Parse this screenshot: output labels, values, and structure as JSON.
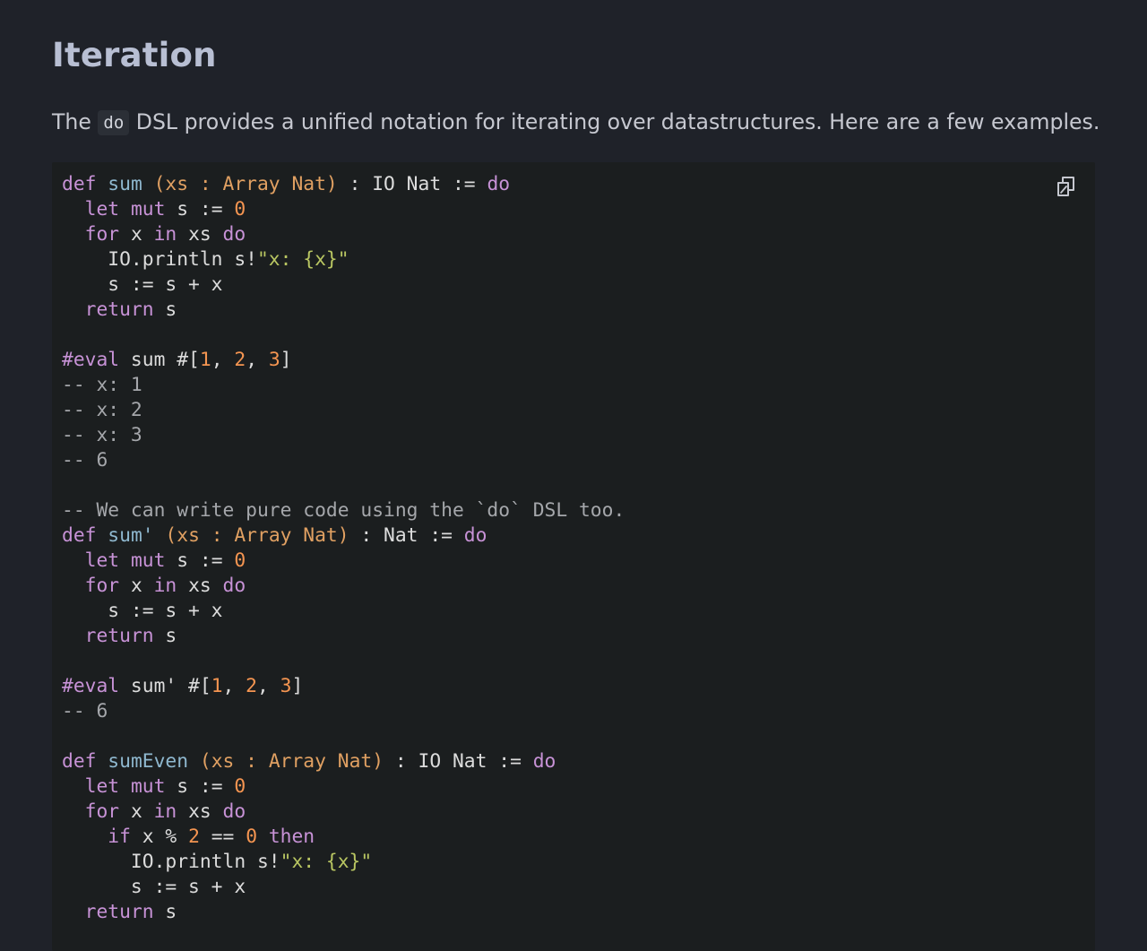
{
  "page": {
    "title": "Iteration",
    "intro_before": "The ",
    "intro_code": "do",
    "intro_after": " DSL provides a unified notation for iterating over datastructures. Here are a few examples."
  },
  "copy_button": {
    "icon": "copy-icon",
    "color": "#c6c8d0"
  },
  "colors": {
    "background": "#1f2229",
    "code_background": "#1b1e1f",
    "keyword": "#c792d6",
    "function_name": "#8fb8cf",
    "binder": "#e0a062",
    "number": "#f59551",
    "string": "#b9c662",
    "comment": "#a5a7ab"
  },
  "code": {
    "lines": [
      [
        {
          "t": "kw",
          "v": "def"
        },
        {
          "t": "txt",
          "v": " "
        },
        {
          "t": "fn",
          "v": "sum"
        },
        {
          "t": "txt",
          "v": " "
        },
        {
          "t": "paren",
          "v": "(xs : Array Nat)"
        },
        {
          "t": "txt",
          "v": " : IO Nat := "
        },
        {
          "t": "kw",
          "v": "do"
        }
      ],
      [
        {
          "t": "txt",
          "v": "  "
        },
        {
          "t": "kw",
          "v": "let"
        },
        {
          "t": "txt",
          "v": " "
        },
        {
          "t": "kw",
          "v": "mut"
        },
        {
          "t": "txt",
          "v": " s := "
        },
        {
          "t": "num",
          "v": "0"
        }
      ],
      [
        {
          "t": "txt",
          "v": "  "
        },
        {
          "t": "kw",
          "v": "for"
        },
        {
          "t": "txt",
          "v": " x "
        },
        {
          "t": "kw",
          "v": "in"
        },
        {
          "t": "txt",
          "v": " xs "
        },
        {
          "t": "kw",
          "v": "do"
        }
      ],
      [
        {
          "t": "txt",
          "v": "    IO.println s!"
        },
        {
          "t": "str",
          "v": "\"x: {x}\""
        }
      ],
      [
        {
          "t": "txt",
          "v": "    s := s + x"
        }
      ],
      [
        {
          "t": "txt",
          "v": "  "
        },
        {
          "t": "kw",
          "v": "return"
        },
        {
          "t": "txt",
          "v": " s"
        }
      ],
      [],
      [
        {
          "t": "kw",
          "v": "#eval"
        },
        {
          "t": "txt",
          "v": " sum #["
        },
        {
          "t": "num",
          "v": "1"
        },
        {
          "t": "txt",
          "v": ", "
        },
        {
          "t": "num",
          "v": "2"
        },
        {
          "t": "txt",
          "v": ", "
        },
        {
          "t": "num",
          "v": "3"
        },
        {
          "t": "txt",
          "v": "]"
        }
      ],
      [
        {
          "t": "cmt",
          "v": "-- x: 1"
        }
      ],
      [
        {
          "t": "cmt",
          "v": "-- x: 2"
        }
      ],
      [
        {
          "t": "cmt",
          "v": "-- x: 3"
        }
      ],
      [
        {
          "t": "cmt",
          "v": "-- 6"
        }
      ],
      [],
      [
        {
          "t": "cmt",
          "v": "-- We can write pure code using the `do` DSL too."
        }
      ],
      [
        {
          "t": "kw",
          "v": "def"
        },
        {
          "t": "txt",
          "v": " "
        },
        {
          "t": "fn",
          "v": "sum'"
        },
        {
          "t": "txt",
          "v": " "
        },
        {
          "t": "paren",
          "v": "(xs : Array Nat)"
        },
        {
          "t": "txt",
          "v": " : Nat := "
        },
        {
          "t": "kw",
          "v": "do"
        }
      ],
      [
        {
          "t": "txt",
          "v": "  "
        },
        {
          "t": "kw",
          "v": "let"
        },
        {
          "t": "txt",
          "v": " "
        },
        {
          "t": "kw",
          "v": "mut"
        },
        {
          "t": "txt",
          "v": " s := "
        },
        {
          "t": "num",
          "v": "0"
        }
      ],
      [
        {
          "t": "txt",
          "v": "  "
        },
        {
          "t": "kw",
          "v": "for"
        },
        {
          "t": "txt",
          "v": " x "
        },
        {
          "t": "kw",
          "v": "in"
        },
        {
          "t": "txt",
          "v": " xs "
        },
        {
          "t": "kw",
          "v": "do"
        }
      ],
      [
        {
          "t": "txt",
          "v": "    s := s + x"
        }
      ],
      [
        {
          "t": "txt",
          "v": "  "
        },
        {
          "t": "kw",
          "v": "return"
        },
        {
          "t": "txt",
          "v": " s"
        }
      ],
      [],
      [
        {
          "t": "kw",
          "v": "#eval"
        },
        {
          "t": "txt",
          "v": " sum' #["
        },
        {
          "t": "num",
          "v": "1"
        },
        {
          "t": "txt",
          "v": ", "
        },
        {
          "t": "num",
          "v": "2"
        },
        {
          "t": "txt",
          "v": ", "
        },
        {
          "t": "num",
          "v": "3"
        },
        {
          "t": "txt",
          "v": "]"
        }
      ],
      [
        {
          "t": "cmt",
          "v": "-- 6"
        }
      ],
      [],
      [
        {
          "t": "kw",
          "v": "def"
        },
        {
          "t": "txt",
          "v": " "
        },
        {
          "t": "fn",
          "v": "sumEven"
        },
        {
          "t": "txt",
          "v": " "
        },
        {
          "t": "paren",
          "v": "(xs : Array Nat)"
        },
        {
          "t": "txt",
          "v": " : IO Nat := "
        },
        {
          "t": "kw",
          "v": "do"
        }
      ],
      [
        {
          "t": "txt",
          "v": "  "
        },
        {
          "t": "kw",
          "v": "let"
        },
        {
          "t": "txt",
          "v": " "
        },
        {
          "t": "kw",
          "v": "mut"
        },
        {
          "t": "txt",
          "v": " s := "
        },
        {
          "t": "num",
          "v": "0"
        }
      ],
      [
        {
          "t": "txt",
          "v": "  "
        },
        {
          "t": "kw",
          "v": "for"
        },
        {
          "t": "txt",
          "v": " x "
        },
        {
          "t": "kw",
          "v": "in"
        },
        {
          "t": "txt",
          "v": " xs "
        },
        {
          "t": "kw",
          "v": "do"
        }
      ],
      [
        {
          "t": "txt",
          "v": "    "
        },
        {
          "t": "kw",
          "v": "if"
        },
        {
          "t": "txt",
          "v": " x % "
        },
        {
          "t": "num",
          "v": "2"
        },
        {
          "t": "txt",
          "v": " == "
        },
        {
          "t": "num",
          "v": "0"
        },
        {
          "t": "txt",
          "v": " "
        },
        {
          "t": "kw",
          "v": "then"
        }
      ],
      [
        {
          "t": "txt",
          "v": "      IO.println s!"
        },
        {
          "t": "str",
          "v": "\"x: {x}\""
        }
      ],
      [
        {
          "t": "txt",
          "v": "      s := s + x"
        }
      ],
      [
        {
          "t": "txt",
          "v": "  "
        },
        {
          "t": "kw",
          "v": "return"
        },
        {
          "t": "txt",
          "v": " s"
        }
      ]
    ]
  }
}
